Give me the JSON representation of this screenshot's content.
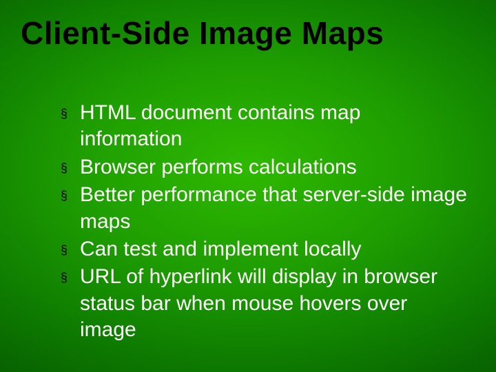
{
  "slide": {
    "title": "Client-Side Image Maps",
    "bullets": [
      "HTML document contains map information",
      "Browser performs calculations",
      "Better performance that server-side image maps",
      "Can test and implement locally",
      "URL of hyperlink will display in browser status bar when mouse hovers over image"
    ]
  }
}
